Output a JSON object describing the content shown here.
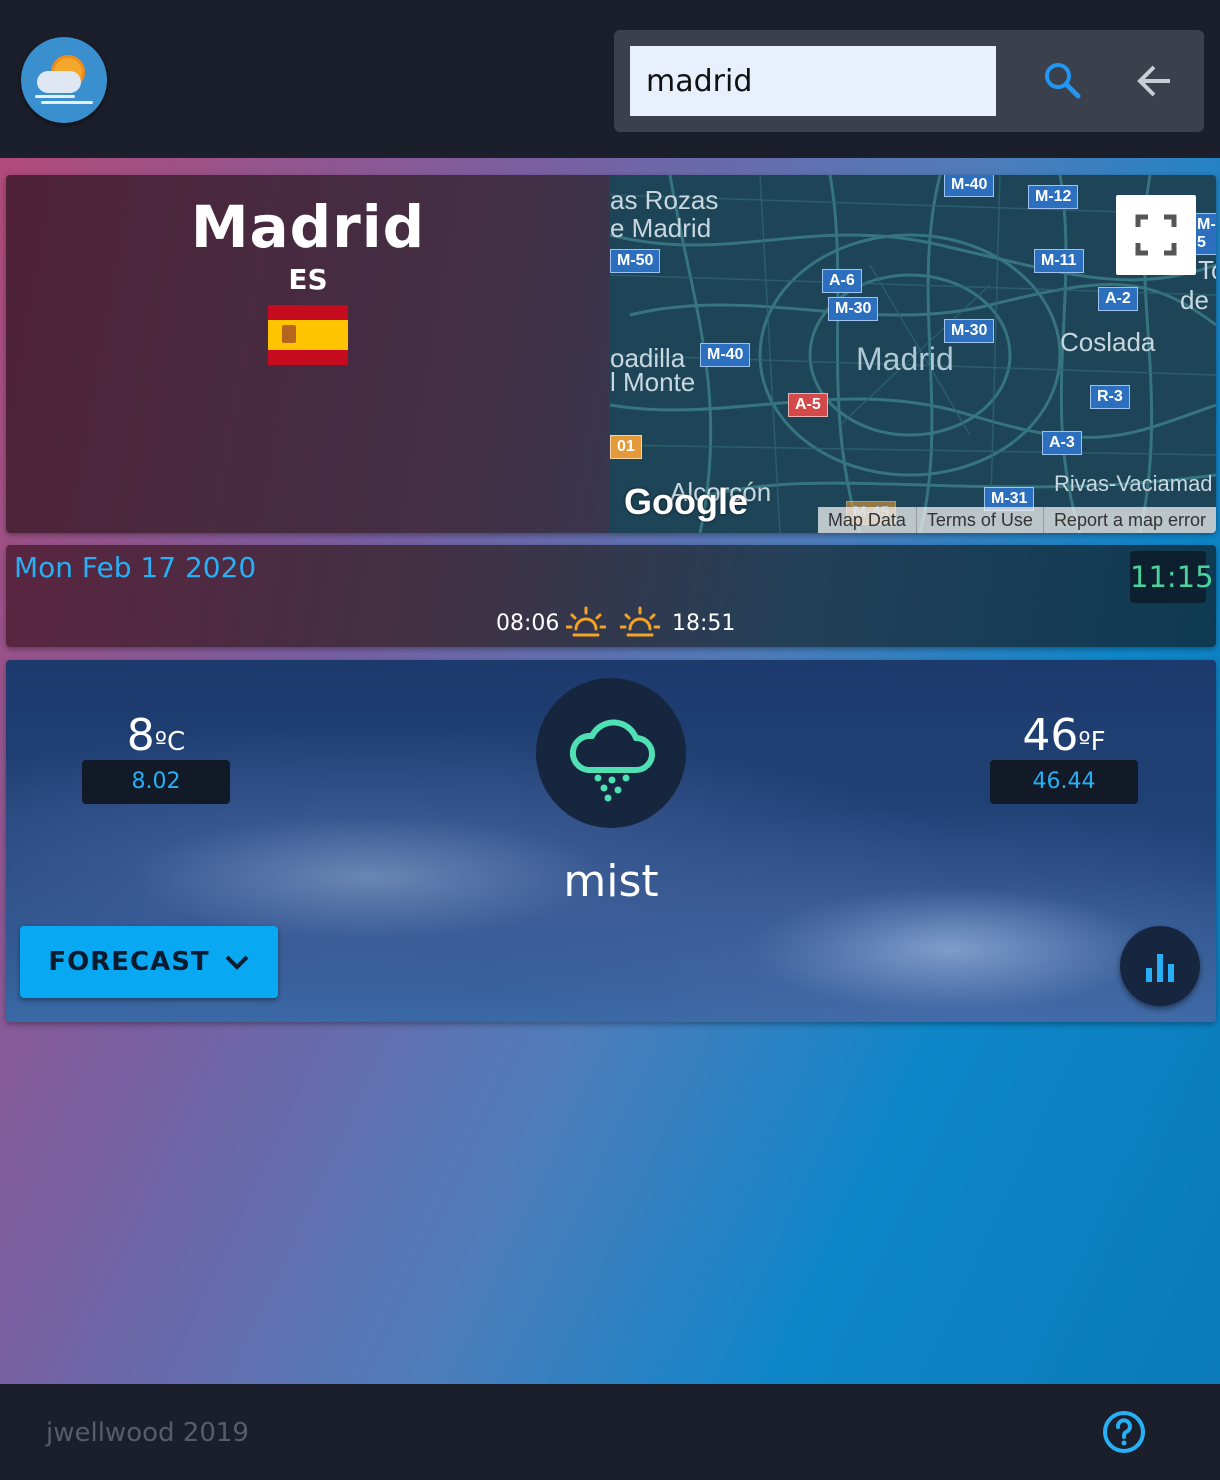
{
  "search": {
    "value": "madrid"
  },
  "city": {
    "name": "Madrid",
    "country": "ES"
  },
  "map": {
    "places": [
      "as Rozas",
      "e Madrid",
      "oadilla",
      "l Monte",
      "Madrid",
      "Coslada",
      "Alcorcón",
      "Rivas-Vaciamad",
      "To",
      "de"
    ],
    "shields": [
      "M-40",
      "M-12",
      "M-5",
      "M-50",
      "A-6",
      "M-11",
      "M-30",
      "A-2",
      "M-30",
      "M-40",
      "A-5",
      "R-3",
      "01",
      "A-3",
      "M-31",
      "M-45"
    ],
    "google_label": "Google",
    "footer": {
      "map_data": "Map Data",
      "terms": "Terms of Use",
      "report": "Report a map error"
    }
  },
  "date": {
    "text": "Mon Feb 17 2020",
    "time": "11:15",
    "sunrise": "08:06",
    "sunset": "18:51"
  },
  "weather": {
    "temp_c": "8",
    "unit_c": "ºC",
    "exact_c": "8.02",
    "temp_f": "46",
    "unit_f": "ºF",
    "exact_f": "46.44",
    "condition": "mist",
    "icon": "cloud-rain-icon"
  },
  "buttons": {
    "forecast": "FORECAST"
  },
  "footer": {
    "credit": "jwellwood 2019"
  },
  "colors": {
    "accent": "#08a8f2",
    "date_text": "#27b0f5",
    "time_text": "#4bd39b",
    "header_bg": "#1a1f2b"
  }
}
